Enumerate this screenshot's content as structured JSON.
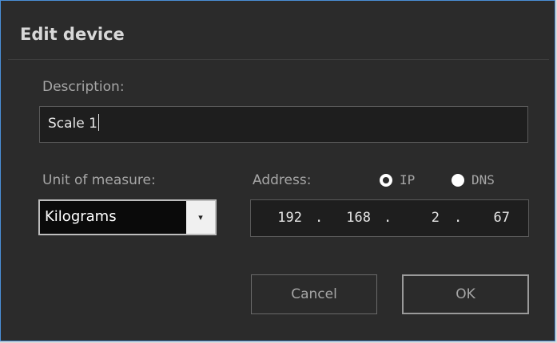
{
  "dialog": {
    "title": "Edit device",
    "description_label": "Description:",
    "description_value": "Scale 1",
    "unit_label": "Unit of measure:",
    "unit_value": "Kilograms",
    "address_label": "Address:",
    "address_mode": {
      "ip_label": "IP",
      "dns_label": "DNS"
    },
    "ip_octets": [
      "192",
      "168",
      "2",
      "67"
    ],
    "ip_separator": ".",
    "cancel_label": "Cancel",
    "ok_label": "OK"
  },
  "icons": {
    "dropdown": "chevron-down-icon",
    "dropdown_glyph": "▾"
  }
}
